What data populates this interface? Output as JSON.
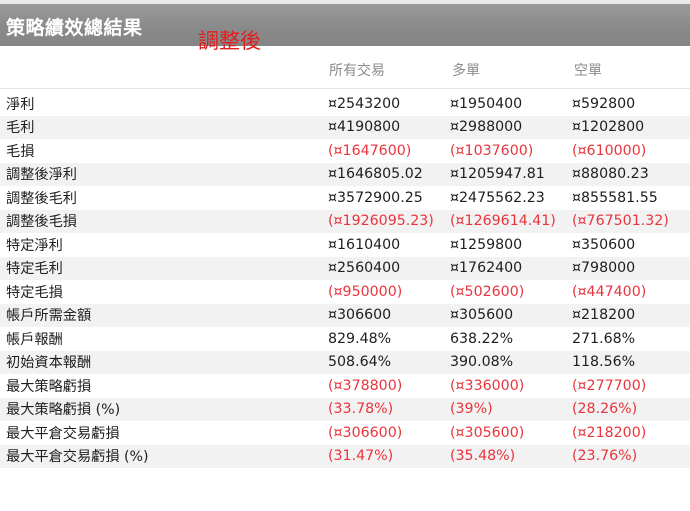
{
  "header": {
    "title": "策略績效總結果",
    "note": "調整後"
  },
  "columns": [
    "所有交易",
    "多單",
    "空單"
  ],
  "rows": [
    {
      "label": "淨利",
      "values": [
        "¤2543200",
        "¤1950400",
        "¤592800"
      ],
      "negative": false
    },
    {
      "label": "毛利",
      "values": [
        "¤4190800",
        "¤2988000",
        "¤1202800"
      ],
      "negative": false
    },
    {
      "label": "毛損",
      "values": [
        "(¤1647600)",
        "(¤1037600)",
        "(¤610000)"
      ],
      "negative": true
    },
    {
      "label": "調整後淨利",
      "values": [
        "¤1646805.02",
        "¤1205947.81",
        "¤88080.23"
      ],
      "negative": false
    },
    {
      "label": "調整後毛利",
      "values": [
        "¤3572900.25",
        "¤2475562.23",
        "¤855581.55"
      ],
      "negative": false
    },
    {
      "label": "調整後毛損",
      "values": [
        "(¤1926095.23)",
        "(¤1269614.41)",
        "(¤767501.32)"
      ],
      "negative": true
    },
    {
      "label": "特定淨利",
      "values": [
        "¤1610400",
        "¤1259800",
        "¤350600"
      ],
      "negative": false
    },
    {
      "label": "特定毛利",
      "values": [
        "¤2560400",
        "¤1762400",
        "¤798000"
      ],
      "negative": false
    },
    {
      "label": "特定毛損",
      "values": [
        "(¤950000)",
        "(¤502600)",
        "(¤447400)"
      ],
      "negative": true
    },
    {
      "label": "帳戶所需金額",
      "values": [
        "¤306600",
        "¤305600",
        "¤218200"
      ],
      "negative": false
    },
    {
      "label": "帳戶報酬",
      "values": [
        "829.48%",
        "638.22%",
        "271.68%"
      ],
      "negative": false
    },
    {
      "label": "初始資本報酬",
      "values": [
        "508.64%",
        "390.08%",
        "118.56%"
      ],
      "negative": false
    },
    {
      "label": "最大策略虧損",
      "values": [
        "(¤378800)",
        "(¤336000)",
        "(¤277700)"
      ],
      "negative": true
    },
    {
      "label": "最大策略虧損 (%)",
      "values": [
        "(33.78%)",
        "(39%)",
        "(28.26%)"
      ],
      "negative": true
    },
    {
      "label": "最大平倉交易虧損",
      "values": [
        "(¤306600)",
        "(¤305600)",
        "(¤218200)"
      ],
      "negative": true
    },
    {
      "label": "最大平倉交易虧損 (%)",
      "values": [
        "(31.47%)",
        "(35.48%)",
        "(23.76%)"
      ],
      "negative": true
    }
  ],
  "colors": {
    "negative": "#e8353d",
    "header_bg": "#8f8f8f",
    "note": "#e02020"
  }
}
